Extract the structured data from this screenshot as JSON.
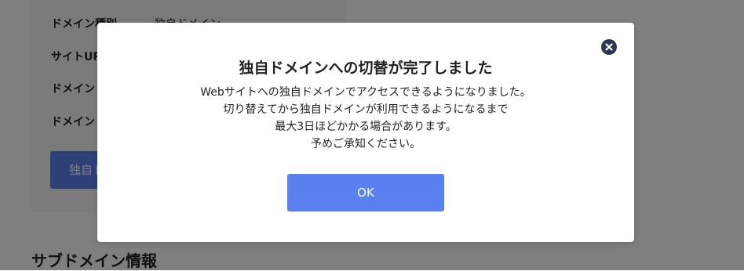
{
  "background": {
    "rows": [
      {
        "label": "ドメイン種別",
        "value": "独自ドメイン"
      },
      {
        "label": "サイトURL",
        "value": ""
      },
      {
        "label": "ドメイン",
        "value": ""
      },
      {
        "label": "ドメイン",
        "value": ""
      }
    ],
    "button_label": "独自ド",
    "section_heading": "サブドメイン情報"
  },
  "modal": {
    "title": "独自ドメインへの切替が完了しました",
    "body_lines": [
      "Webサイトへの独自ドメインでアクセスできるようになりました。",
      "切り替えてから独自ドメインが利用できるようになるまで",
      "最大3日ほどかかる場合があります。",
      "予めご承知ください。"
    ],
    "ok_label": "OK",
    "close_icon": "close-icon"
  },
  "colors": {
    "primary_button": "#5b80f0",
    "close_button": "#2e3350",
    "overlay": "rgba(0,0,0,0.5)"
  }
}
